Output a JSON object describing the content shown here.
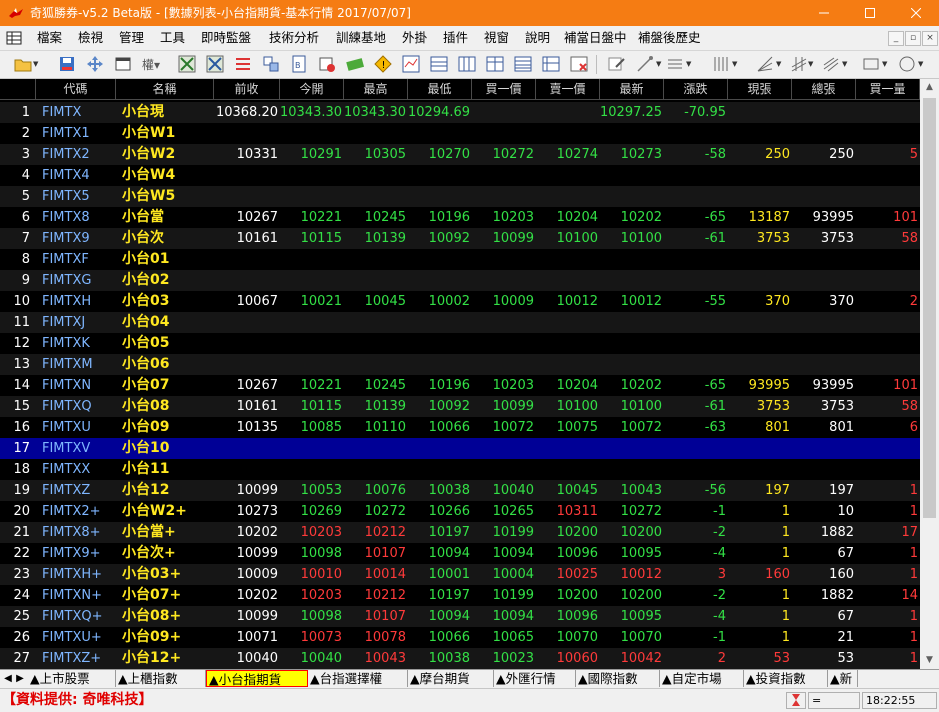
{
  "window": {
    "title": "奇狐勝券-v5.2 Beta版 - [數據列表-小台指期貨-基本行情 2017/07/07]"
  },
  "menu": [
    "檔案",
    "檢視",
    "管理",
    "工具",
    "即時監盤",
    "技術分析",
    "訓練基地",
    "外掛",
    "插件",
    "視窗",
    "說明",
    "補當日盤中",
    "補盤後歷史"
  ],
  "columns": [
    "代碼",
    "名稱",
    "前收",
    "今開",
    "最高",
    "最低",
    "買一價",
    "賣一價",
    "最新",
    "漲跌",
    "現張",
    "總張",
    "買一量"
  ],
  "rows": [
    {
      "idx": "1",
      "code": "FIMTX",
      "name": "小台現",
      "prev": "10368.20",
      "open": "10343.30",
      "high": "10343.30",
      "low": "10294.69",
      "bid": "",
      "ask": "",
      "last": "10297.25",
      "chg": "-70.95",
      "vol": "",
      "total": "",
      "bidq": ""
    },
    {
      "idx": "2",
      "code": "FIMTX1",
      "name": "小台W1",
      "prev": "",
      "open": "",
      "high": "",
      "low": "",
      "bid": "",
      "ask": "",
      "last": "",
      "chg": "",
      "vol": "",
      "total": "",
      "bidq": ""
    },
    {
      "idx": "3",
      "code": "FIMTX2",
      "name": "小台W2",
      "prev": "10331",
      "open": "10291",
      "high": "10305",
      "low": "10270",
      "bid": "10272",
      "ask": "10274",
      "last": "10273",
      "chg": "-58",
      "vol": "250",
      "total": "250",
      "bidq": "5"
    },
    {
      "idx": "4",
      "code": "FIMTX4",
      "name": "小台W4",
      "prev": "",
      "open": "",
      "high": "",
      "low": "",
      "bid": "",
      "ask": "",
      "last": "",
      "chg": "",
      "vol": "",
      "total": "",
      "bidq": ""
    },
    {
      "idx": "5",
      "code": "FIMTX5",
      "name": "小台W5",
      "prev": "",
      "open": "",
      "high": "",
      "low": "",
      "bid": "",
      "ask": "",
      "last": "",
      "chg": "",
      "vol": "",
      "total": "",
      "bidq": ""
    },
    {
      "idx": "6",
      "code": "FIMTX8",
      "name": "小台當",
      "prev": "10267",
      "open": "10221",
      "high": "10245",
      "low": "10196",
      "bid": "10203",
      "ask": "10204",
      "last": "10202",
      "chg": "-65",
      "vol": "13187",
      "total": "93995",
      "bidq": "101"
    },
    {
      "idx": "7",
      "code": "FIMTX9",
      "name": "小台次",
      "prev": "10161",
      "open": "10115",
      "high": "10139",
      "low": "10092",
      "bid": "10099",
      "ask": "10100",
      "last": "10100",
      "chg": "-61",
      "vol": "3753",
      "total": "3753",
      "bidq": "58"
    },
    {
      "idx": "8",
      "code": "FIMTXF",
      "name": "小台01",
      "prev": "",
      "open": "",
      "high": "",
      "low": "",
      "bid": "",
      "ask": "",
      "last": "",
      "chg": "",
      "vol": "",
      "total": "",
      "bidq": ""
    },
    {
      "idx": "9",
      "code": "FIMTXG",
      "name": "小台02",
      "prev": "",
      "open": "",
      "high": "",
      "low": "",
      "bid": "",
      "ask": "",
      "last": "",
      "chg": "",
      "vol": "",
      "total": "",
      "bidq": ""
    },
    {
      "idx": "10",
      "code": "FIMTXH",
      "name": "小台03",
      "prev": "10067",
      "open": "10021",
      "high": "10045",
      "low": "10002",
      "bid": "10009",
      "ask": "10012",
      "last": "10012",
      "chg": "-55",
      "vol": "370",
      "total": "370",
      "bidq": "2"
    },
    {
      "idx": "11",
      "code": "FIMTXJ",
      "name": "小台04",
      "prev": "",
      "open": "",
      "high": "",
      "low": "",
      "bid": "",
      "ask": "",
      "last": "",
      "chg": "",
      "vol": "",
      "total": "",
      "bidq": ""
    },
    {
      "idx": "12",
      "code": "FIMTXK",
      "name": "小台05",
      "prev": "",
      "open": "",
      "high": "",
      "low": "",
      "bid": "",
      "ask": "",
      "last": "",
      "chg": "",
      "vol": "",
      "total": "",
      "bidq": ""
    },
    {
      "idx": "13",
      "code": "FIMTXM",
      "name": "小台06",
      "prev": "",
      "open": "",
      "high": "",
      "low": "",
      "bid": "",
      "ask": "",
      "last": "",
      "chg": "",
      "vol": "",
      "total": "",
      "bidq": ""
    },
    {
      "idx": "14",
      "code": "FIMTXN",
      "name": "小台07",
      "prev": "10267",
      "open": "10221",
      "high": "10245",
      "low": "10196",
      "bid": "10203",
      "ask": "10204",
      "last": "10202",
      "chg": "-65",
      "vol": "93995",
      "total": "93995",
      "bidq": "101"
    },
    {
      "idx": "15",
      "code": "FIMTXQ",
      "name": "小台08",
      "prev": "10161",
      "open": "10115",
      "high": "10139",
      "low": "10092",
      "bid": "10099",
      "ask": "10100",
      "last": "10100",
      "chg": "-61",
      "vol": "3753",
      "total": "3753",
      "bidq": "58"
    },
    {
      "idx": "16",
      "code": "FIMTXU",
      "name": "小台09",
      "prev": "10135",
      "open": "10085",
      "high": "10110",
      "low": "10066",
      "bid": "10072",
      "ask": "10075",
      "last": "10072",
      "chg": "-63",
      "vol": "801",
      "total": "801",
      "bidq": "6"
    },
    {
      "idx": "17",
      "code": "FIMTXV",
      "name": "小台10",
      "prev": "",
      "open": "",
      "high": "",
      "low": "",
      "bid": "",
      "ask": "",
      "last": "",
      "chg": "",
      "vol": "",
      "total": "",
      "bidq": "",
      "selected": true
    },
    {
      "idx": "18",
      "code": "FIMTXX",
      "name": "小台11",
      "prev": "",
      "open": "",
      "high": "",
      "low": "",
      "bid": "",
      "ask": "",
      "last": "",
      "chg": "",
      "vol": "",
      "total": "",
      "bidq": ""
    },
    {
      "idx": "19",
      "code": "FIMTXZ",
      "name": "小台12",
      "prev": "10099",
      "open": "10053",
      "high": "10076",
      "low": "10038",
      "bid": "10040",
      "ask": "10045",
      "last": "10043",
      "chg": "-56",
      "vol": "197",
      "total": "197",
      "bidq": "1"
    },
    {
      "idx": "20",
      "code": "FIMTX2+",
      "name": "小台W2+",
      "prev": "10273",
      "open": "10269",
      "high": "10272",
      "low": "10266",
      "bid": "10265",
      "ask": "10311",
      "last": "10272",
      "chg": "-1",
      "vol": "1",
      "total": "10",
      "bidq": "1"
    },
    {
      "idx": "21",
      "code": "FIMTX8+",
      "name": "小台當+",
      "prev": "10202",
      "open": "10203",
      "high": "10212",
      "low": "10197",
      "bid": "10199",
      "ask": "10200",
      "last": "10200",
      "chg": "-2",
      "vol": "1",
      "total": "1882",
      "bidq": "17"
    },
    {
      "idx": "22",
      "code": "FIMTX9+",
      "name": "小台次+",
      "prev": "10099",
      "open": "10098",
      "high": "10107",
      "low": "10094",
      "bid": "10094",
      "ask": "10096",
      "last": "10095",
      "chg": "-4",
      "vol": "1",
      "total": "67",
      "bidq": "1"
    },
    {
      "idx": "23",
      "code": "FIMTXH+",
      "name": "小台03+",
      "prev": "10009",
      "open": "10010",
      "high": "10014",
      "low": "10001",
      "bid": "10004",
      "ask": "10025",
      "last": "10012",
      "chg": "3",
      "vol": "160",
      "total": "160",
      "bidq": "1"
    },
    {
      "idx": "24",
      "code": "FIMTXN+",
      "name": "小台07+",
      "prev": "10202",
      "open": "10203",
      "high": "10212",
      "low": "10197",
      "bid": "10199",
      "ask": "10200",
      "last": "10200",
      "chg": "-2",
      "vol": "1",
      "total": "1882",
      "bidq": "14"
    },
    {
      "idx": "25",
      "code": "FIMTXQ+",
      "name": "小台08+",
      "prev": "10099",
      "open": "10098",
      "high": "10107",
      "low": "10094",
      "bid": "10094",
      "ask": "10096",
      "last": "10095",
      "chg": "-4",
      "vol": "1",
      "total": "67",
      "bidq": "1"
    },
    {
      "idx": "26",
      "code": "FIMTXU+",
      "name": "小台09+",
      "prev": "10071",
      "open": "10073",
      "high": "10078",
      "low": "10066",
      "bid": "10065",
      "ask": "10070",
      "last": "10070",
      "chg": "-1",
      "vol": "1",
      "total": "21",
      "bidq": "1"
    },
    {
      "idx": "27",
      "code": "FIMTXZ+",
      "name": "小台12+",
      "prev": "10040",
      "open": "10040",
      "high": "10043",
      "low": "10038",
      "bid": "10023",
      "ask": "10060",
      "last": "10042",
      "chg": "2",
      "vol": "53",
      "total": "53",
      "bidq": "1"
    }
  ],
  "tabs": [
    "▲上市股票",
    "▲上櫃指數",
    "▲小台指期貨",
    "▲台指選擇權",
    "▲摩台期貨",
    "▲外匯行情",
    "▲國際指數",
    "▲自定市場",
    "▲投資指數",
    "▲新"
  ],
  "active_tab": 2,
  "status": {
    "provider": "【資料提供: 奇唯科技】",
    "equals": "=",
    "time": "18:22:55"
  },
  "colors": {
    "titlebar": "#f57c13",
    "up": "#ff3a3a",
    "down": "#33e046",
    "flat": "#ffffff",
    "name": "#ffe820",
    "code": "#7fb6ff",
    "selected_row": "#000096"
  },
  "icons": {
    "app": "fox-logo-icon",
    "toolbar": [
      "open-folder-icon",
      "save-icon",
      "move-icon",
      "window-icon",
      "grid-icon",
      "chart-x-icon",
      "chart-x2-icon",
      "list-icon",
      "copy-icon",
      "doc-icon",
      "delete-icon",
      "money-icon",
      "warning-icon",
      "chart-line-icon",
      "table-icon",
      "table2-icon",
      "table3-icon",
      "cross-icon",
      "edit-icon",
      "pen-icon",
      "ruler-icon",
      "bars-icon",
      "fan-icon",
      "parallel-icon",
      "rect-icon",
      "circle-icon"
    ]
  }
}
